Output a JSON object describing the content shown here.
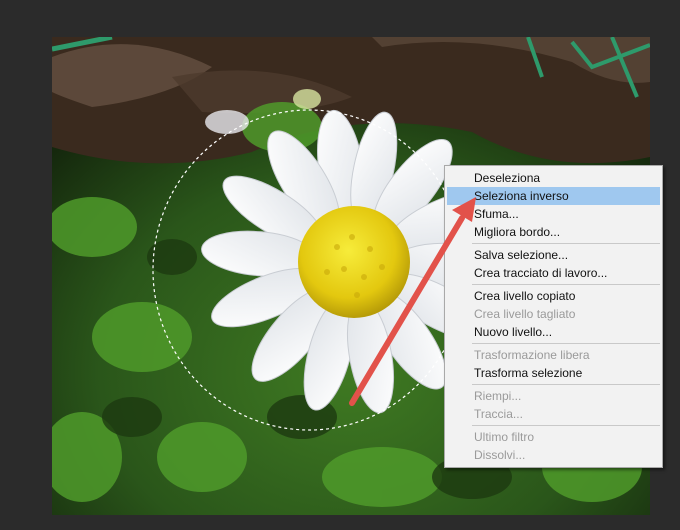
{
  "context_menu": {
    "groups": [
      [
        {
          "label": "Deseleziona",
          "enabled": true,
          "highlighted": false
        },
        {
          "label": "Seleziona inverso",
          "enabled": true,
          "highlighted": true
        },
        {
          "label": "Sfuma...",
          "enabled": true,
          "highlighted": false
        },
        {
          "label": "Migliora bordo...",
          "enabled": true,
          "highlighted": false
        }
      ],
      [
        {
          "label": "Salva selezione...",
          "enabled": true,
          "highlighted": false
        },
        {
          "label": "Crea tracciato di lavoro...",
          "enabled": true,
          "highlighted": false
        }
      ],
      [
        {
          "label": "Crea livello copiato",
          "enabled": true,
          "highlighted": false
        },
        {
          "label": "Crea livello tagliato",
          "enabled": false,
          "highlighted": false
        },
        {
          "label": "Nuovo livello...",
          "enabled": true,
          "highlighted": false
        }
      ],
      [
        {
          "label": "Trasformazione libera",
          "enabled": false,
          "highlighted": false
        },
        {
          "label": "Trasforma selezione",
          "enabled": true,
          "highlighted": false
        }
      ],
      [
        {
          "label": "Riempi...",
          "enabled": false,
          "highlighted": false
        },
        {
          "label": "Traccia...",
          "enabled": false,
          "highlighted": false
        }
      ],
      [
        {
          "label": "Ultimo filtro",
          "enabled": false,
          "highlighted": false
        },
        {
          "label": "Dissolvi...",
          "enabled": false,
          "highlighted": false
        }
      ]
    ]
  },
  "colors": {
    "highlight": "#9fc8ef",
    "arrow": "#e2524a",
    "menu_bg": "#f2f2f2",
    "app_bg": "#2b2b2b"
  }
}
